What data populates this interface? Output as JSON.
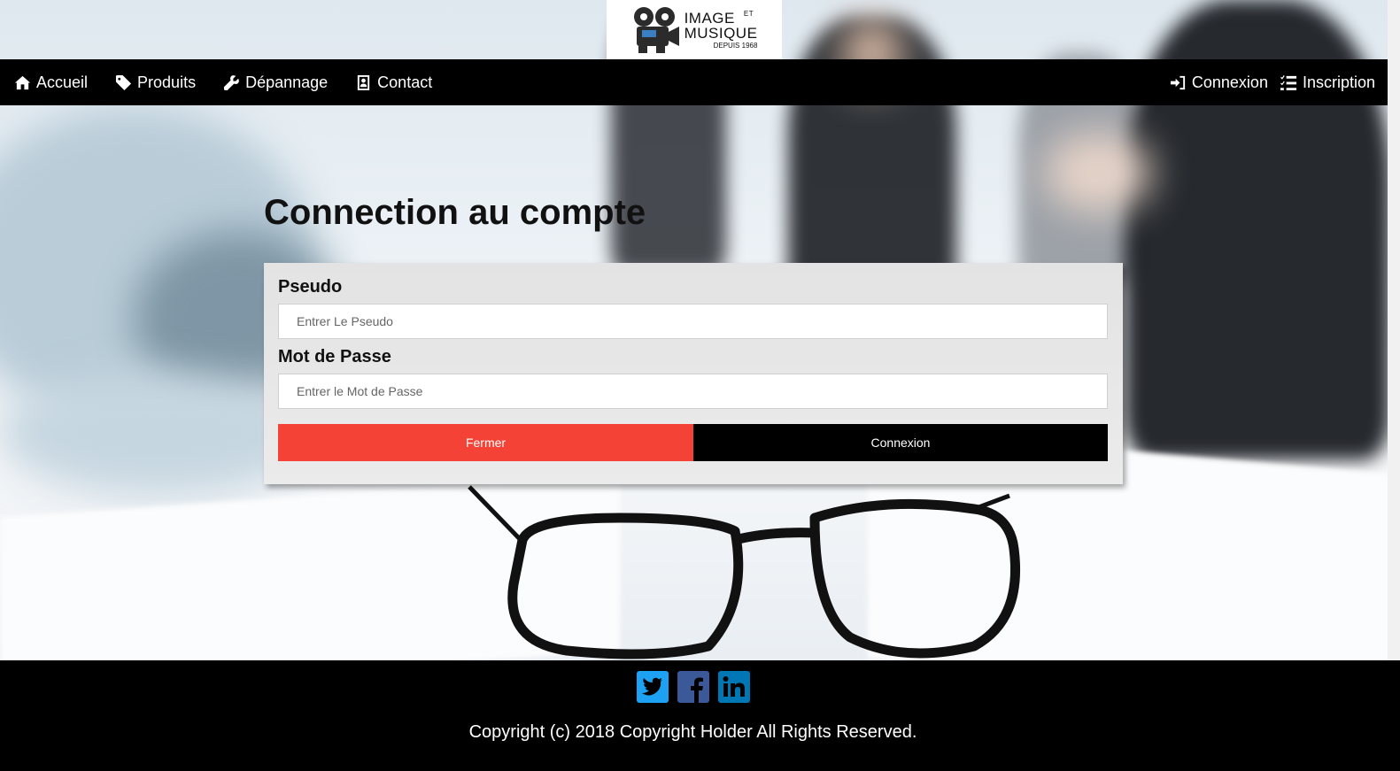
{
  "logo": {
    "line1": "IMAGE",
    "et": "ET",
    "line2": "MUSIQUE",
    "line3": "DEPUIS 1968"
  },
  "nav": {
    "left": [
      {
        "label": "Accueil",
        "icon": "home-icon"
      },
      {
        "label": "Produits",
        "icon": "tag-icon"
      },
      {
        "label": "Dépannage",
        "icon": "wrench-icon"
      },
      {
        "label": "Contact",
        "icon": "contact-card-icon"
      }
    ],
    "right": [
      {
        "label": "Connexion",
        "icon": "sign-in-icon"
      },
      {
        "label": "Inscription",
        "icon": "list-check-icon"
      }
    ]
  },
  "main": {
    "title": "Connection au compte",
    "form": {
      "pseudo_label": "Pseudo",
      "pseudo_placeholder": "Entrer Le Pseudo",
      "password_label": "Mot de Passe",
      "password_placeholder": "Entrer le Mot de Passe",
      "close_label": "Fermer",
      "submit_label": "Connexion"
    }
  },
  "footer": {
    "social": [
      {
        "name": "twitter-icon",
        "color": "#1da1f2"
      },
      {
        "name": "facebook-icon",
        "color": "#3b5998"
      },
      {
        "name": "linkedin-icon",
        "color": "#0077b5"
      }
    ],
    "copyright": "Copyright (c) 2018 Copyright Holder All Rights Reserved."
  },
  "colors": {
    "nav_bg": "#000000",
    "close_button": "#f44336",
    "submit_button": "#000000"
  }
}
